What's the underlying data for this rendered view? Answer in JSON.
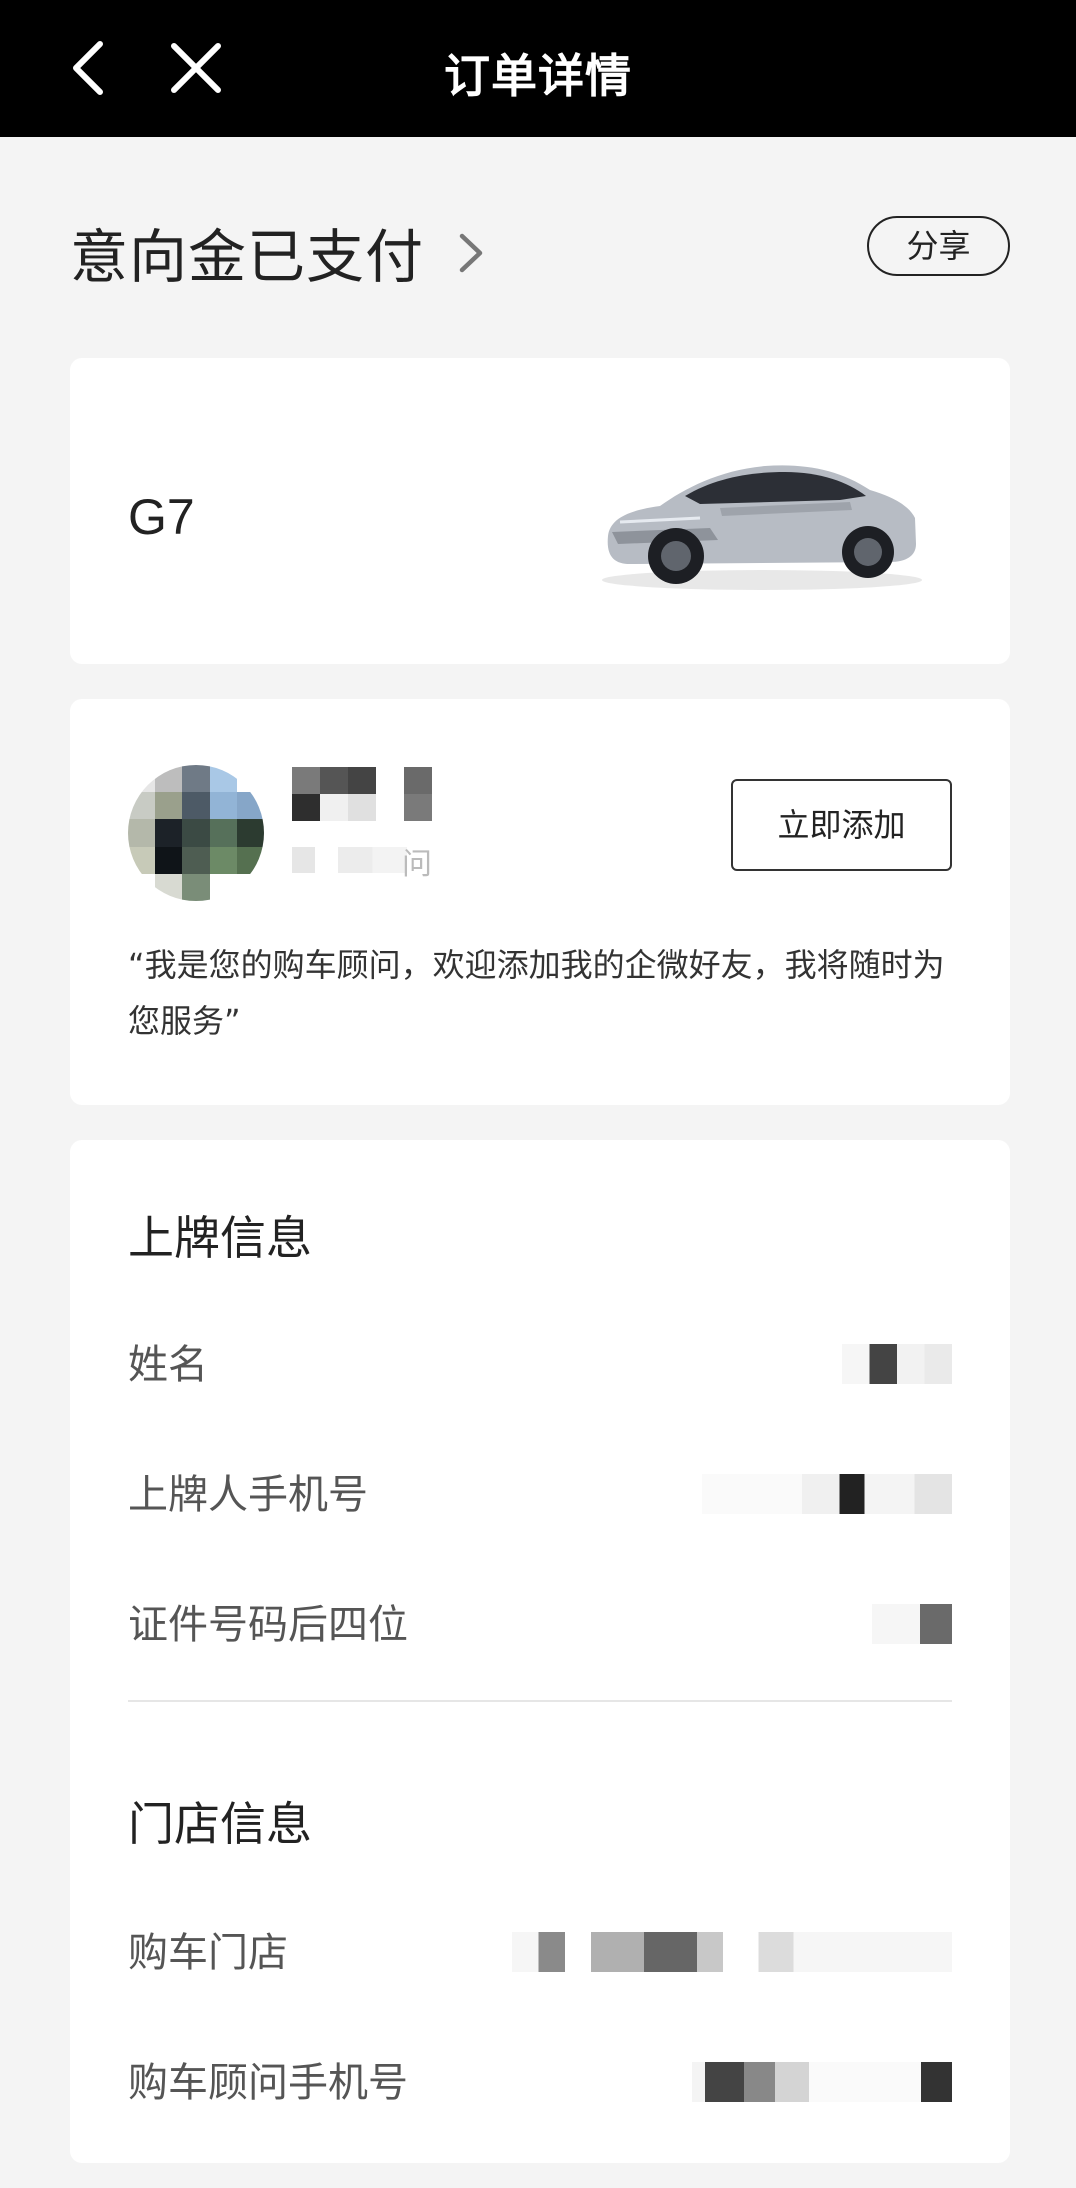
{
  "header": {
    "title": "订单详情"
  },
  "status": {
    "title": "意向金已支付",
    "share_label": "分享"
  },
  "car": {
    "model": "G7"
  },
  "advisor": {
    "title_suffix": "问",
    "add_label": "立即添加",
    "quote": "“我是您的购车顾问，欢迎添加我的企微好友，我将随时为您服务”"
  },
  "registration": {
    "section_title": "上牌信息",
    "rows": [
      {
        "label": "姓名"
      },
      {
        "label": "上牌人手机号"
      },
      {
        "label": "证件号码后四位"
      }
    ]
  },
  "store": {
    "section_title": "门店信息",
    "rows": [
      {
        "label": "购车门店"
      },
      {
        "label": "购车顾问手机号"
      }
    ]
  }
}
